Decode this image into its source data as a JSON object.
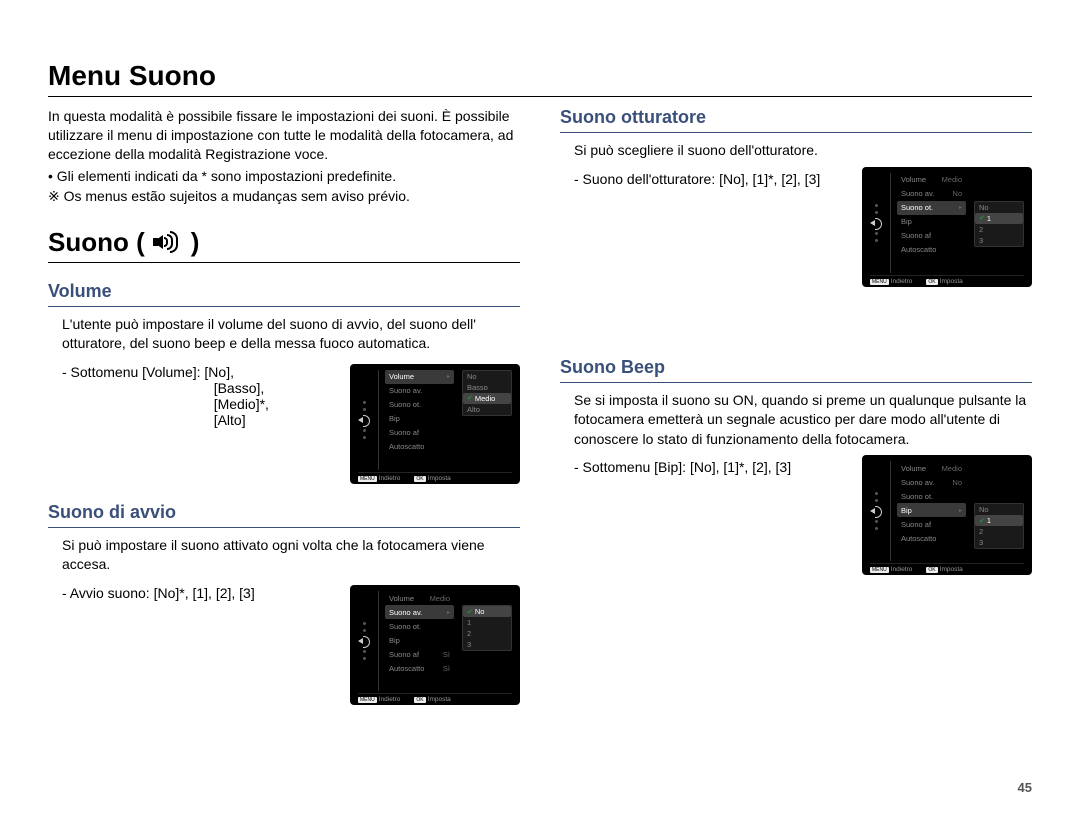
{
  "title": "Menu Suono",
  "intro": "In questa modalità è possibile fissare le impostazioni dei suoni. È possibile utilizzare il menu di impostazione con tutte le modalità della fotocamera, ad eccezione della modalità Registrazione voce.",
  "bullet_default": "• Gli elementi indicati da * sono impostazioni predefinite.",
  "bullet_warning": "※ Os menus estão sujeitos a mudanças sem aviso prévio.",
  "suono_heading": "Suono (",
  "suono_heading_close": ")",
  "volume": {
    "heading": "Volume",
    "text": "L'utente può impostare il volume del suono di avvio, del suono dell' otturatore, del suono beep e della messa fuoco automatica.",
    "submenu": "- Sottomenu [Volume]: [No],\n                                       [Basso],\n                                       [Medio]*,\n                                       [Alto]"
  },
  "avvio": {
    "heading": "Suono di avvio",
    "text": "Si può impostare il suono attivato ogni volta che la fotocamera viene accesa.",
    "submenu": "- Avvio suono: [No]*, [1], [2], [3]"
  },
  "otturatore": {
    "heading": "Suono otturatore",
    "text": "Si può scegliere il suono dell'otturatore.",
    "submenu": "- Suono dell'otturatore: [No], [1]*, [2], [3]"
  },
  "beep": {
    "heading": "Suono Beep",
    "text": "Se si imposta il suono su ON, quando si preme un qualunque pulsante la fotocamera emetterà un segnale acustico per dare modo all'utente di conoscere lo stato di funzionamento della fotocamera.",
    "submenu": "- Sottomenu [Bip]: [No], [1]*, [2], [3]"
  },
  "camera_labels": {
    "volume": "Volume",
    "suono_av": "Suono av.",
    "suono_ot": "Suono ot.",
    "bip": "Bip",
    "suono_af": "Suono af",
    "autoscatto": "Autoscatto",
    "indietro": "Indietro",
    "imposta": "Imposta",
    "menu_btn": "MENU",
    "ok_btn": "OK"
  },
  "camera_vals": {
    "no": "No",
    "basso": "Basso",
    "medio": "Medio",
    "alto": "Alto",
    "one": "1",
    "two": "2",
    "three": "3",
    "si": "Sì",
    "medio_short": "Medio"
  },
  "page_no": "45"
}
